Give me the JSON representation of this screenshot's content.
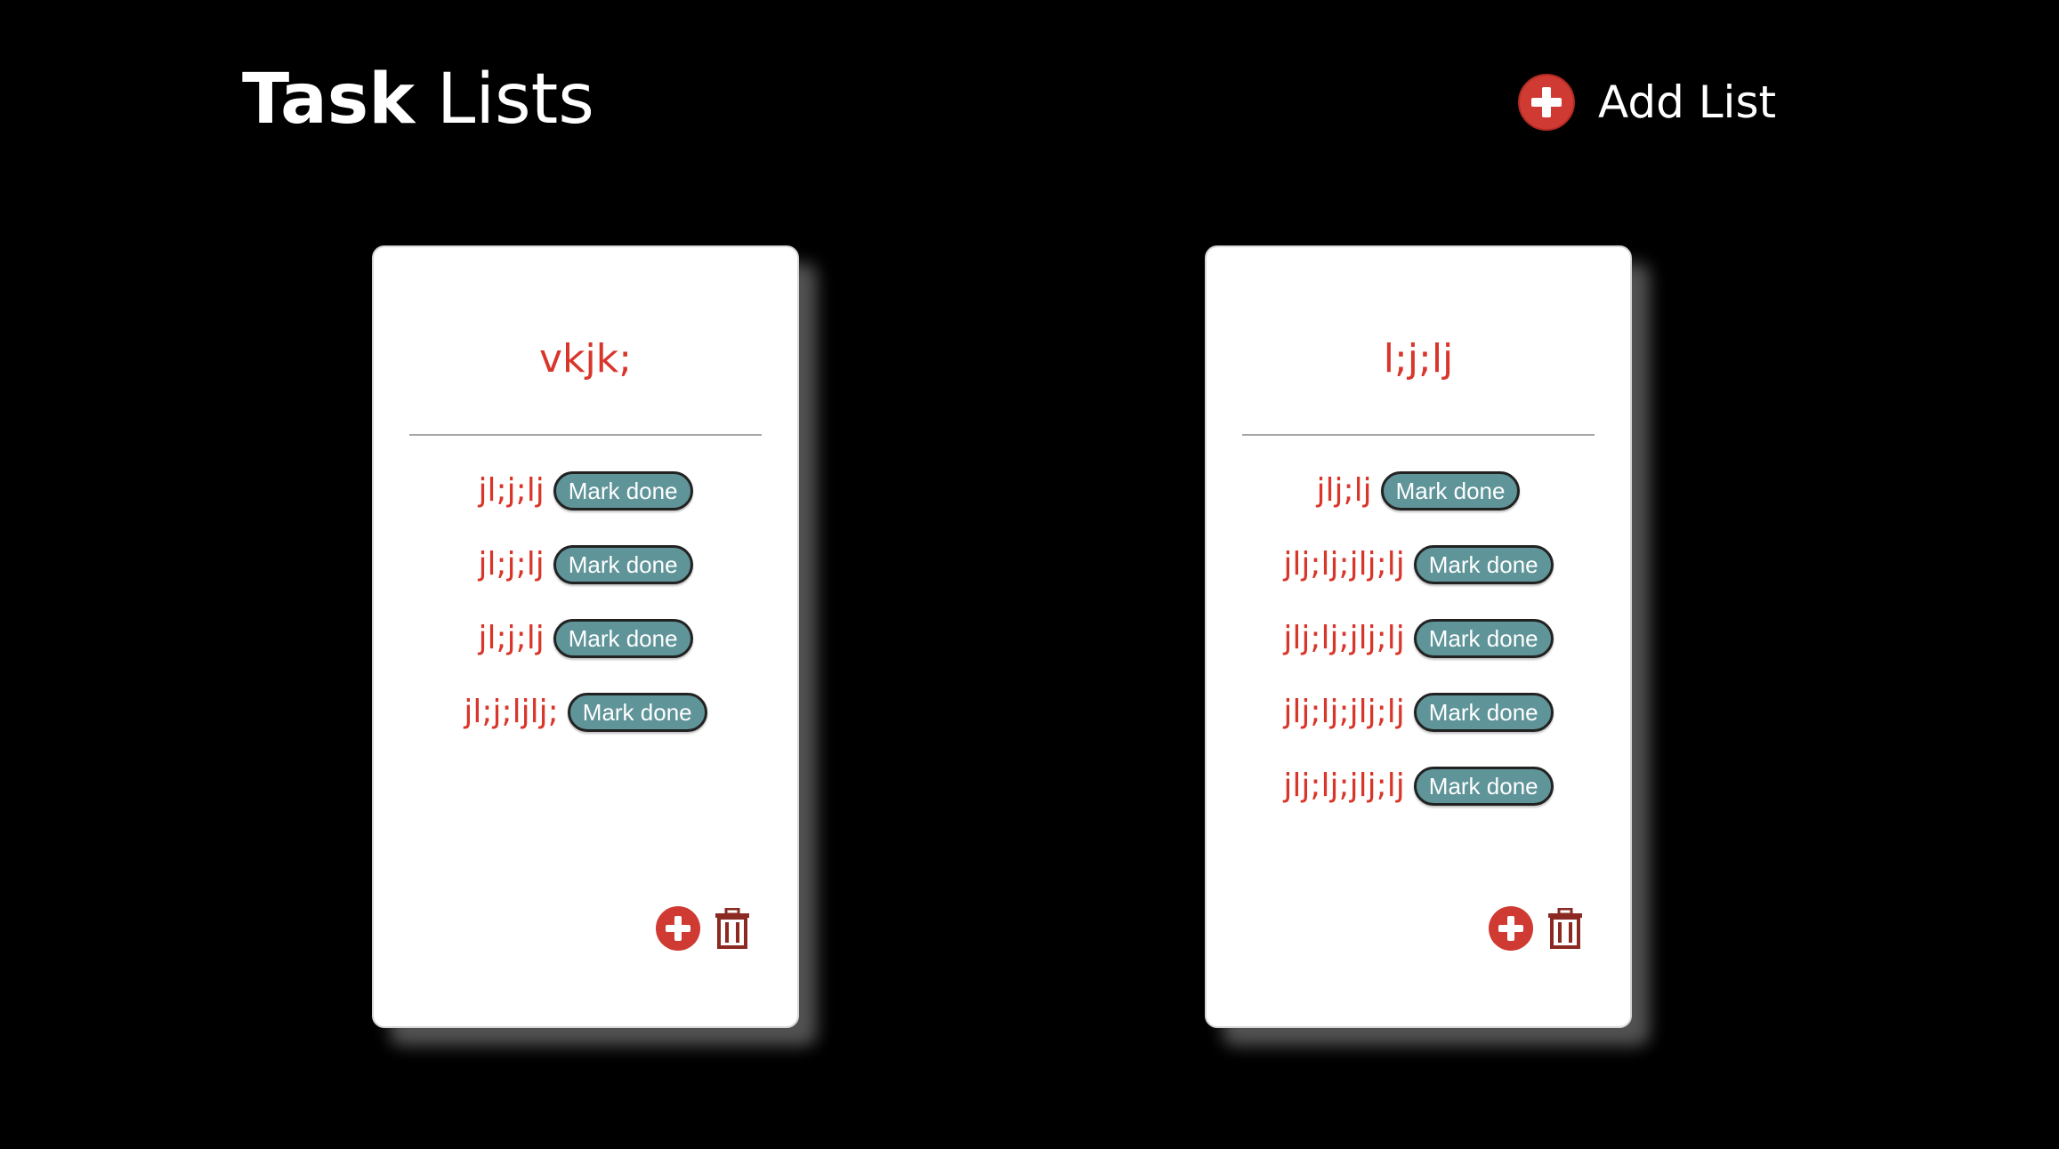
{
  "header": {
    "title_bold": "Task",
    "title_rest": "Lists",
    "add_list_label": "Add List"
  },
  "colors": {
    "background": "#000000",
    "accent_red": "#d9362b",
    "button_teal": "#5f9499"
  },
  "icons": {
    "add": "plus-circle-icon",
    "delete": "trash-icon"
  },
  "lists": [
    {
      "title": "vkjk;",
      "tasks": [
        {
          "text": "jl;j;lj",
          "button": "Mark done"
        },
        {
          "text": "jl;j;lj",
          "button": "Mark done"
        },
        {
          "text": "jl;j;lj",
          "button": "Mark done"
        },
        {
          "text": "jl;j;ljlj;",
          "button": "Mark done"
        }
      ]
    },
    {
      "title": "l;j;lj",
      "tasks": [
        {
          "text": "jlj;lj",
          "button": "Mark done"
        },
        {
          "text": "jlj;lj;jlj;lj",
          "button": "Mark done"
        },
        {
          "text": "jlj;lj;jlj;lj",
          "button": "Mark done"
        },
        {
          "text": "jlj;lj;jlj;lj",
          "button": "Mark done"
        },
        {
          "text": "jlj;lj;jlj;lj",
          "button": "Mark done"
        }
      ]
    }
  ]
}
